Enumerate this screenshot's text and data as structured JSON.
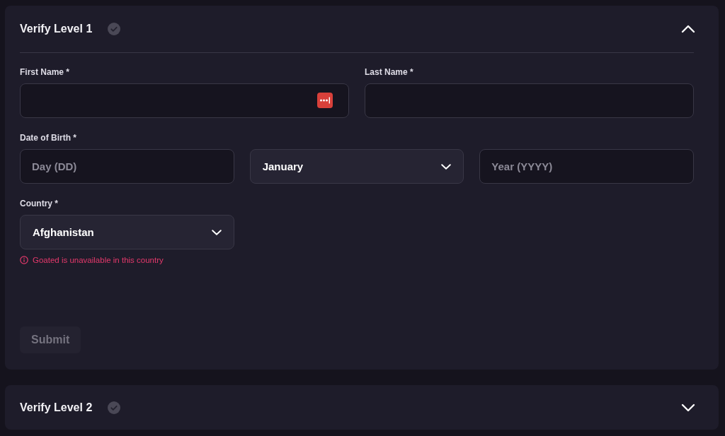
{
  "sections": [
    {
      "title": "Verify Level 1",
      "expanded": true,
      "form": {
        "groups": [
          {
            "fields": [
              {
                "label": "First Name *",
                "kind": "text",
                "autofill_icon": true
              },
              {
                "label": "Last Name *",
                "kind": "text",
                "autofill_icon": false
              }
            ]
          },
          {
            "label": "Date of Birth *",
            "fields": [
              {
                "kind": "text",
                "placeholder": "Day (DD)",
                "autofill_icon": false
              },
              {
                "kind": "select",
                "value": "January"
              },
              {
                "kind": "text",
                "placeholder": "Year (YYYY)",
                "autofill_icon": false
              }
            ]
          },
          {
            "label": "Country *",
            "fields": [
              {
                "kind": "select",
                "value": "Afghanistan"
              }
            ],
            "error": "Goated is unavailable in this country"
          }
        ],
        "submit": {
          "label": "Submit",
          "disabled": true
        }
      }
    },
    {
      "title": "Verify Level 2",
      "expanded": false
    }
  ]
}
